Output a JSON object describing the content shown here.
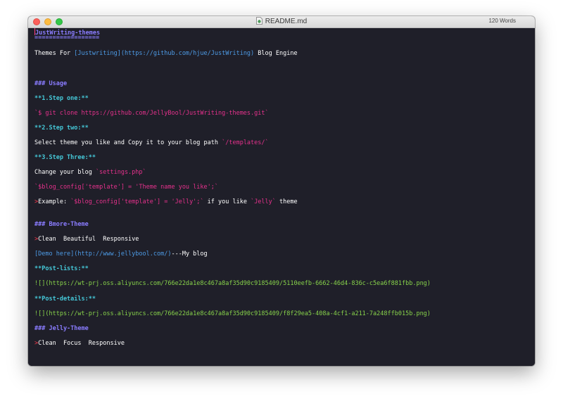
{
  "window": {
    "title": "README.md",
    "word_count": "120 Words"
  },
  "editor": {
    "title_line": "JustWriting-themes",
    "title_underline": "==================",
    "intro_prefix": "Themes For ",
    "intro_link": "[Justwriting](https://github.com/hjue/JustWriting)",
    "intro_suffix": " Blog Engine",
    "usage_heading": "### Usage",
    "step1": "**1.Step one:**",
    "step1_code": "`$ git clone https://github.com/JellyBool/JustWriting-themes.git`",
    "step2": "**2.Step two:**",
    "step2_text": "Select theme you like and Copy it to your blog path ",
    "step2_code": "`/templates/`",
    "step3": "**3.Step Three:**",
    "step3_text": "Change your blog ",
    "step3_code": "`settings.php`",
    "config_code": "`$blog_config['template'] = 'Theme name you like';`",
    "example_marker": ">",
    "example_text": "Example: ",
    "example_code": "`$blog_config['template'] = 'Jelly';`",
    "example_mid": " if you like ",
    "example_code2": "`Jelly`",
    "example_suffix": " theme",
    "bmore_heading": "### Bmore-Theme",
    "bmore_marker": ">",
    "bmore_features": "Clean  Beautiful  Responsive",
    "demo_link": "[Demo here](http://www.jellybool.com/)",
    "demo_suffix": "---My blog",
    "post_lists": "**Post-lists:**",
    "post_lists_img": "![](https://wt-prj.oss.aliyuncs.com/766e22da1e8c467a8af35d90c9185409/5110eefb-6662-46d4-836c-c5ea6f881fbb.png)",
    "post_details": "**Post-details:**",
    "post_details_img": "![](https://wt-prj.oss.aliyuncs.com/766e22da1e8c467a8af35d90c9185409/f8f29ea5-408a-4cf1-a211-7a248ffb015b.png)",
    "jelly_heading": "### Jelly-Theme",
    "jelly_marker": ">",
    "jelly_features": "Clean  Focus  Responsive"
  },
  "colors": {
    "background": "#1f1f29",
    "heading": "#8a7cff",
    "bold": "#45c8d8",
    "code": "#e6318c",
    "link": "#4d9be6",
    "url": "#87d24a",
    "quote_marker": "#ff3a4d"
  }
}
